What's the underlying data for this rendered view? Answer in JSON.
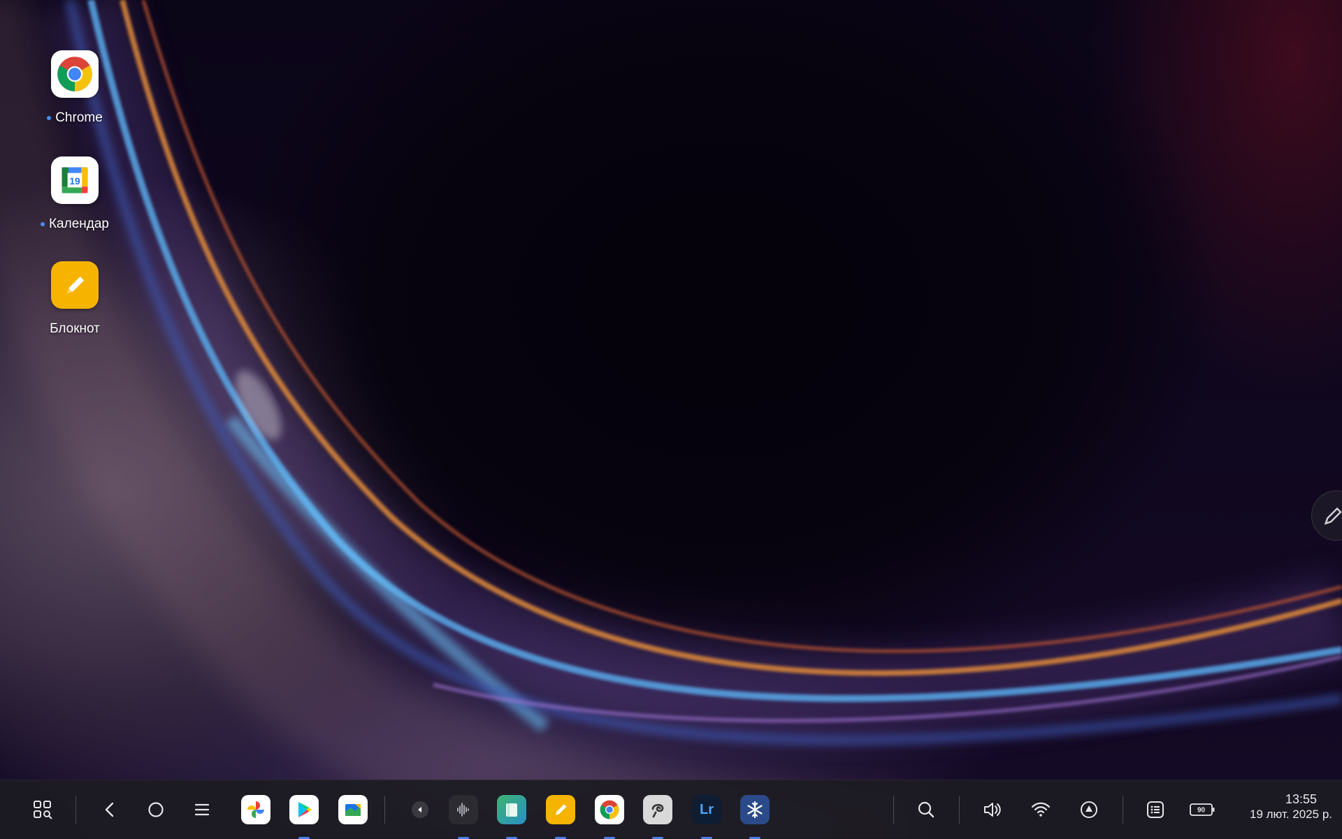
{
  "desktop": {
    "icons": [
      {
        "label": "Chrome",
        "icon": "chrome-icon",
        "new": true
      },
      {
        "label": "Календар",
        "icon": "calendar-icon",
        "new": true,
        "calendar_day": "19"
      },
      {
        "label": "Блокнот",
        "icon": "notepad-icon",
        "new": false
      }
    ]
  },
  "taskbar": {
    "system_buttons": [
      "app-grid-icon",
      "back-icon",
      "home-icon",
      "recents-icon"
    ],
    "pinned_apps": [
      "photos-icon",
      "play-store-icon",
      "files-icon"
    ],
    "collapse_arrow": "triangle-left-icon",
    "running_apps": [
      {
        "icon": "sound-recorder-icon",
        "bg": "#2b2b31"
      },
      {
        "icon": "books-icon",
        "bg": "#3fae8c"
      },
      {
        "icon": "notepad-icon",
        "bg": "#f6b400"
      },
      {
        "icon": "chrome-icon",
        "bg": "#ffffff"
      },
      {
        "icon": "clip-studio-icon",
        "bg": "#d9d9d9"
      },
      {
        "icon": "lightroom-icon",
        "bg": "#0f1d33",
        "text": "Lr"
      },
      {
        "icon": "snowflake-icon",
        "bg": "#2b4a8a"
      }
    ],
    "tray": {
      "icons": [
        "search-icon",
        "volume-icon",
        "wifi-icon",
        "navigation-icon",
        "notifications-icon",
        "battery-icon"
      ],
      "battery_level": "90",
      "time": "13:55",
      "date": "19 лют. 2025 р."
    }
  },
  "colors": {
    "accent": "#4a7ee8",
    "taskbar": "#1c1b21"
  }
}
